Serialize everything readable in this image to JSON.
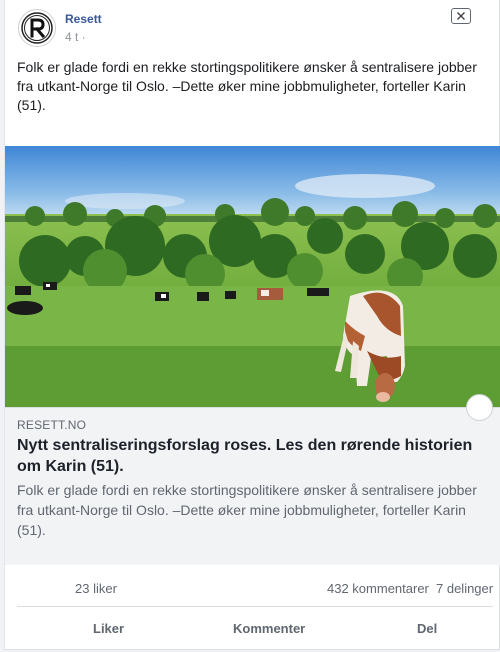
{
  "post": {
    "page_name": "Resett",
    "timestamp": "4 t ·",
    "text": "Folk er glade fordi en rekke stortingspolitikere ønsker å sentralisere jobber fra utkant-Norge til Oslo. –Dette øker mine jobbmuligheter, forteller Karin (51).",
    "icons": {
      "avatar": "resett-logo",
      "close": "close-icon"
    }
  },
  "link": {
    "domain": "RESETT.NO",
    "headline": "Nytt sentraliseringsforslag roses. Les den rørende historien om Karin (51).",
    "description": "Folk er glade fordi en rekke stortingspolitikere ønsker å sentralisere jobber fra utkant-Norge til Oslo. –Dette øker mine jobbmuligheter, forteller Karin (51)."
  },
  "stats": {
    "likes": "23 liker",
    "comments": "432 kommentarer",
    "shares": "7 delinger"
  },
  "actions": {
    "like": "Liker",
    "comment": "Kommenter",
    "share": "Del"
  },
  "colors": {
    "page_name": "#385898",
    "secondary_text": "#606770",
    "link_box_bg": "#f2f3f5"
  }
}
